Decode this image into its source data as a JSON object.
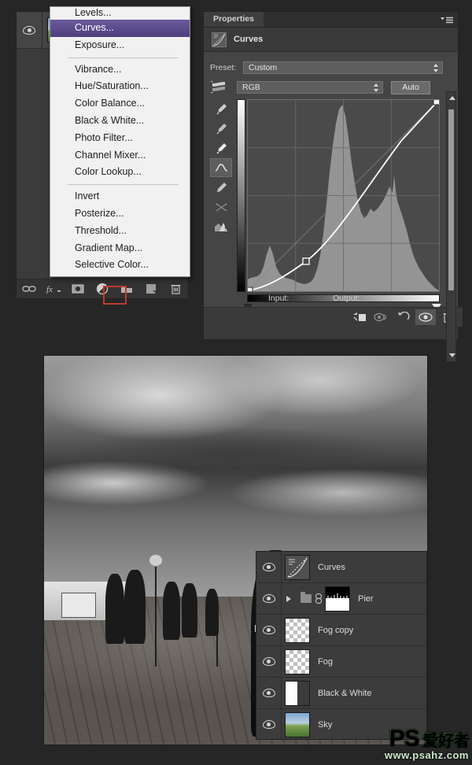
{
  "layers_panel_top": {
    "visible_layer": {
      "name": "",
      "icon": "eye-icon",
      "thumb": "sky-thumbnail"
    },
    "toolbar": [
      {
        "name": "link-layers-icon",
        "label": "Link layers"
      },
      {
        "name": "layer-style-icon",
        "label": "fx"
      },
      {
        "name": "layer-mask-icon",
        "label": "Add layer mask"
      },
      {
        "name": "adjustment-layer-icon",
        "label": "New fill or adjustment layer",
        "highlighted": true
      },
      {
        "name": "new-group-icon",
        "label": "New group"
      },
      {
        "name": "new-layer-icon",
        "label": "New layer"
      },
      {
        "name": "delete-layer-icon",
        "label": "Delete layer"
      }
    ]
  },
  "adjust_menu": {
    "items": [
      {
        "label": "Levels...",
        "selected": false,
        "clipped": true
      },
      {
        "label": "Curves...",
        "selected": true
      },
      {
        "label": "Exposure...",
        "selected": false
      },
      {
        "separator": true
      },
      {
        "label": "Vibrance...",
        "selected": false
      },
      {
        "label": "Hue/Saturation...",
        "selected": false
      },
      {
        "label": "Color Balance...",
        "selected": false
      },
      {
        "label": "Black & White...",
        "selected": false
      },
      {
        "label": "Photo Filter...",
        "selected": false
      },
      {
        "label": "Channel Mixer...",
        "selected": false
      },
      {
        "label": "Color Lookup...",
        "selected": false
      },
      {
        "separator": true
      },
      {
        "label": "Invert",
        "selected": false
      },
      {
        "label": "Posterize...",
        "selected": false
      },
      {
        "label": "Threshold...",
        "selected": false
      },
      {
        "label": "Gradient Map...",
        "selected": false
      },
      {
        "label": "Selective Color...",
        "selected": false
      }
    ],
    "highlight_color": "#584a8c"
  },
  "properties": {
    "tab_label": "Properties",
    "panel_menu_icon": "panel-menu-icon",
    "title": "Curves",
    "title_icon": "curves-icon",
    "preset_label": "Preset:",
    "preset_value": "Custom",
    "channel_value": "RGB",
    "auto_label": "Auto",
    "input_label": "Input:",
    "output_label": "Output:",
    "input_value": "",
    "output_value": "",
    "tools": [
      {
        "name": "sample-black-point-eyedropper-icon"
      },
      {
        "name": "sample-gray-point-eyedropper-icon"
      },
      {
        "name": "sample-white-point-eyedropper-icon"
      },
      {
        "name": "edit-curve-points-icon",
        "active": true
      },
      {
        "name": "draw-curve-pencil-icon"
      },
      {
        "name": "smooth-curve-icon"
      },
      {
        "name": "clipping-warning-icon"
      }
    ],
    "footer_buttons": [
      {
        "name": "clip-to-layer-icon"
      },
      {
        "name": "toggle-previous-state-icon"
      },
      {
        "name": "reset-icon"
      },
      {
        "name": "toggle-visibility-icon",
        "active": true
      },
      {
        "name": "delete-adjustment-icon"
      }
    ]
  },
  "curves_graph": {
    "points": [
      {
        "input": 0,
        "output": 0
      },
      {
        "input": 78,
        "output": 25
      },
      {
        "input": 255,
        "output": 255
      }
    ],
    "grid_divisions": 4,
    "curve_color": "#ffffff",
    "baseline_color": "#787878",
    "histogram_color": "#9a9a9a",
    "black_point": 0,
    "white_point": 255
  },
  "layers": {
    "rows": [
      {
        "name": "Curves",
        "thumb": "curves-adjustment-thumbnail",
        "visible": true
      },
      {
        "name": "Pier",
        "thumb": "layer-mask-thumbnail",
        "visible": true,
        "group": true,
        "linked": true
      },
      {
        "name": "Fog copy",
        "thumb": "transparent-checker-thumbnail",
        "visible": true
      },
      {
        "name": "Fog",
        "thumb": "transparent-checker-thumbnail",
        "visible": true
      },
      {
        "name": "Black & White",
        "thumb": "black-white-adjustment-thumbnail",
        "visible": true
      },
      {
        "name": "Sky",
        "thumb": "sky-photo-thumbnail",
        "visible": true
      }
    ]
  },
  "photo": {
    "description": "Black and white photograph of a pier boardwalk with dramatic storm clouds, lamp posts and walking people"
  },
  "watermark": {
    "ps": "PS",
    "cn": "爱好者",
    "url": "www.psahz.com",
    "color": "#1f8a2e"
  }
}
